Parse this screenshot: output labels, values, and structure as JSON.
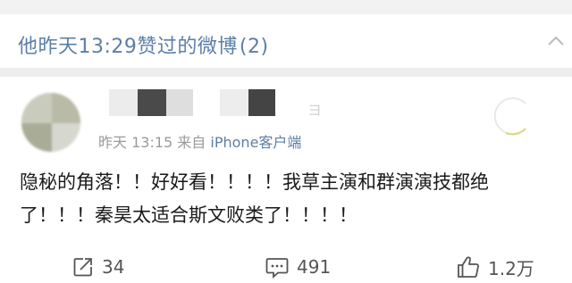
{
  "header": {
    "title": "他昨天13:29赞过的微博",
    "count": "(2)",
    "chevron_icon": "chevron-up-icon"
  },
  "post": {
    "author_name_redacted": true,
    "meta": {
      "time": "昨天 13:15",
      "from_label": "来自",
      "source": "iPhone客户端"
    },
    "content_lines": [
      "隐秘的角落！！好好看！！！！我草主演和群演演技都绝",
      "了！！！秦昊太适合斯文败类了！！！！"
    ],
    "actions": {
      "repost": {
        "icon": "repost-icon",
        "count": "34"
      },
      "comment": {
        "icon": "comment-icon",
        "count": "491"
      },
      "like": {
        "icon": "like-icon",
        "count": "1.2万"
      }
    }
  },
  "colors": {
    "link": "#5b7fa6",
    "text": "#1a1a1a",
    "meta": "#9a9a9a",
    "divider": "#eeeeee"
  }
}
